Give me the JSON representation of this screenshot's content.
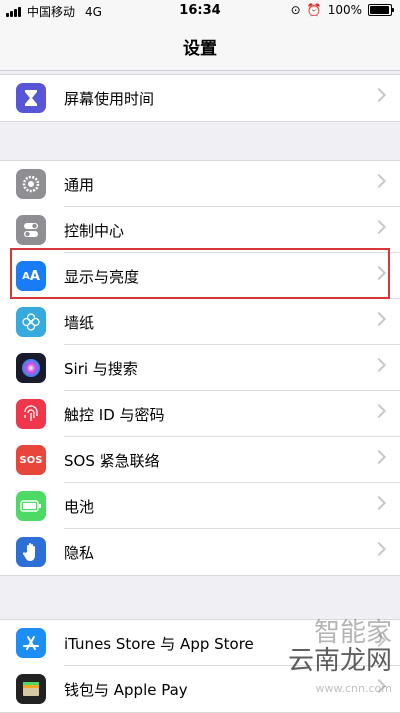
{
  "status_bar": {
    "carrier": "中国移动",
    "network": "4G",
    "time": "16:34",
    "battery": "100%"
  },
  "nav": {
    "title": "设置"
  },
  "groups": {
    "g0": [
      {
        "label": "屏幕使用时间",
        "icon": "hourglass-icon",
        "color": "#5856d6"
      }
    ],
    "g1": [
      {
        "label": "通用",
        "icon": "gear-icon",
        "color": "#8e8e93"
      },
      {
        "label": "控制中心",
        "icon": "toggles-icon",
        "color": "#8e8e93"
      },
      {
        "label": "显示与亮度",
        "icon": "text-size-icon",
        "color": "#1a7cf5"
      },
      {
        "label": "墙纸",
        "icon": "flower-icon",
        "color": "#36aadc"
      },
      {
        "label": "Siri 与搜索",
        "icon": "siri-icon",
        "color": "#222"
      },
      {
        "label": "触控 ID 与密码",
        "icon": "fingerprint-icon",
        "color": "#f0364a"
      },
      {
        "label": "SOS 紧急联络",
        "icon": "sos-icon",
        "color": "#e8453b",
        "text": "SOS"
      },
      {
        "label": "电池",
        "icon": "battery-icon",
        "color": "#4cd964"
      },
      {
        "label": "隐私",
        "icon": "hand-icon",
        "color": "#2c6fd6"
      }
    ],
    "g2": [
      {
        "label": "iTunes Store 与 App Store",
        "icon": "app-store-icon",
        "color": "#1c8ef5"
      },
      {
        "label": "钱包与 Apple Pay",
        "icon": "wallet-icon",
        "color": "#222"
      }
    ]
  },
  "watermark": {
    "line1": "智能家",
    "line2": "云南龙网",
    "line3": "www.cnn.com"
  }
}
